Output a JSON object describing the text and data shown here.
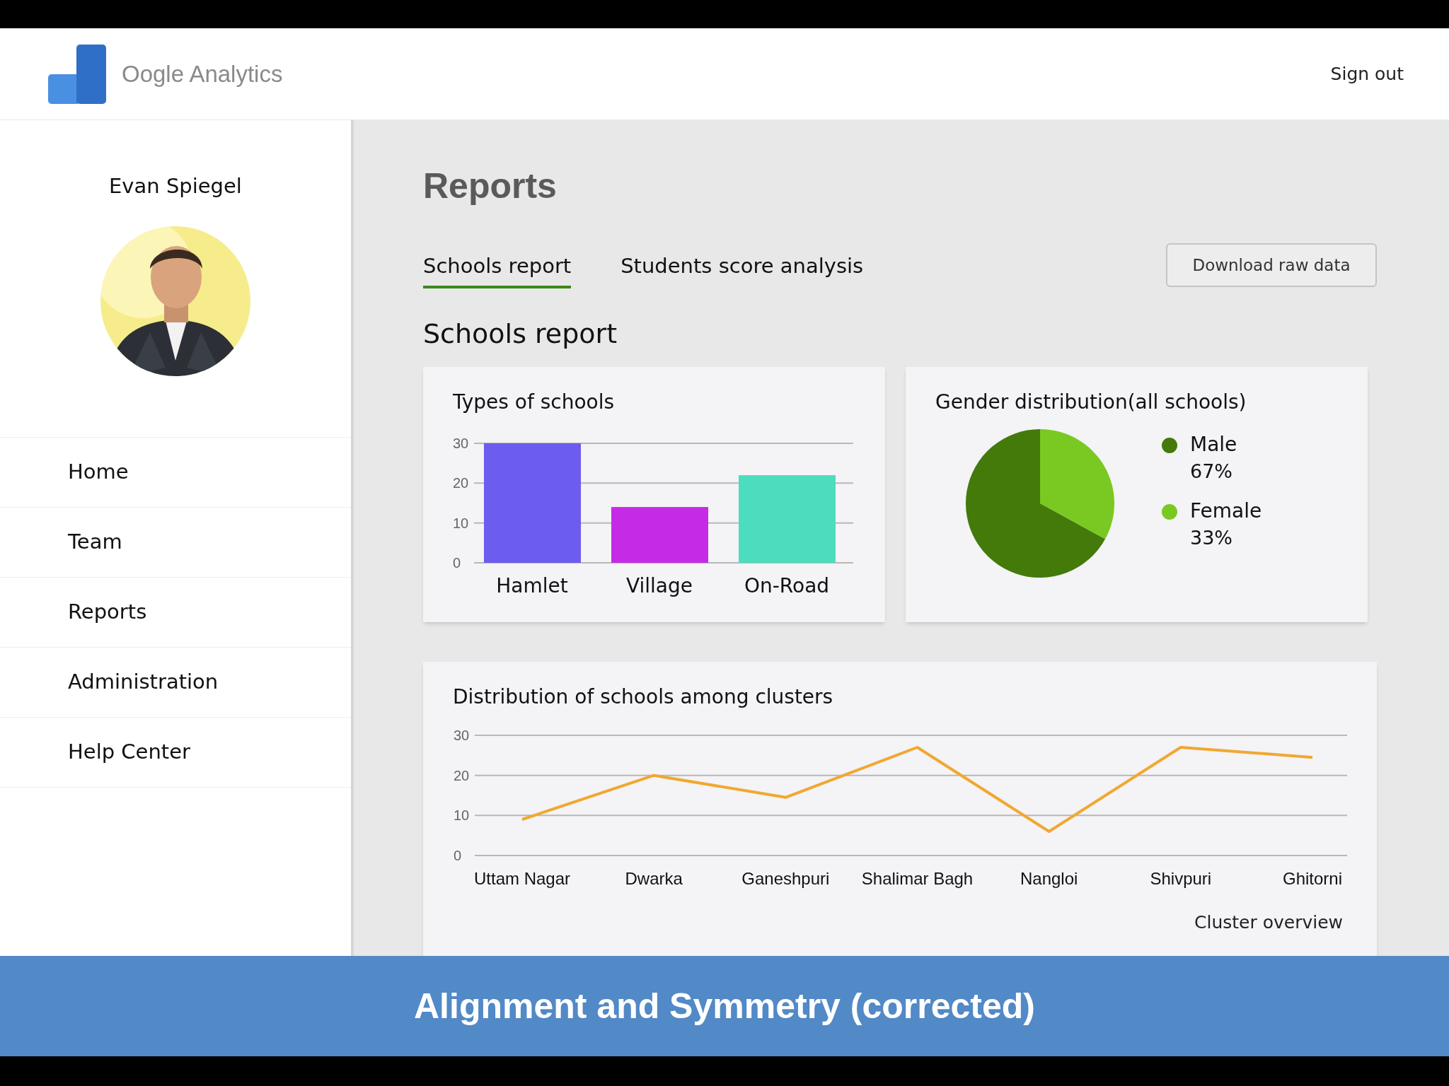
{
  "header": {
    "app_name": "Oogle Analytics",
    "sign_out": "Sign out"
  },
  "sidebar": {
    "user_name": "Evan Spiegel",
    "items": [
      {
        "label": "Home"
      },
      {
        "label": "Team"
      },
      {
        "label": "Reports"
      },
      {
        "label": "Administration"
      },
      {
        "label": "Help Center"
      }
    ]
  },
  "page_title": "Reports",
  "tabs": [
    {
      "label": "Schools report",
      "selected": true
    },
    {
      "label": "Students score analysis",
      "selected": false
    }
  ],
  "download_button": "Download raw data",
  "section_title": "Schools report",
  "cards": [
    {
      "title": "Types of schools",
      "chart_data": {
        "type": "bar",
        "categories": [
          "Hamlet",
          "Village",
          "On-Road"
        ],
        "stacked": true,
        "series": [
          {
            "color": "#6c5cf0",
            "values": [
              30,
              null,
              null
            ]
          },
          {
            "color": "#c52be6",
            "values": [
              null,
              14,
              null
            ]
          },
          {
            "color": "#4edcbf",
            "values": [
              null,
              null,
              22
            ]
          }
        ],
        "ylim": [
          0,
          30
        ],
        "yticks": [
          0,
          10,
          20,
          30
        ]
      }
    },
    {
      "title": "Gender distribution(all schools)",
      "chart_data": {
        "type": "pie",
        "categories": [
          "Male",
          "Female"
        ],
        "series": [
          {
            "values": [
              67,
              33
            ]
          }
        ],
        "colors": [
          "#437a0a",
          "#79c922"
        ],
        "value_labels": [
          "67%",
          "33%"
        ]
      }
    }
  ],
  "cluster_card": {
    "title": "Distribution of schools among clusters",
    "footer": "Cluster overview",
    "chart_data": {
      "type": "line",
      "categories": [
        "Uttam Nagar",
        "Dwarka",
        "Ganeshpuri",
        "Shalimar Bagh",
        "Nangloi",
        "Shivpuri",
        "Ghitorni"
      ],
      "series": [
        {
          "color": "#f0a830",
          "values": [
            9,
            20,
            14.5,
            27,
            6,
            27,
            24.5
          ]
        }
      ],
      "ylim": [
        0,
        30
      ],
      "yticks": [
        0,
        10,
        20,
        30
      ]
    }
  },
  "banner": "Alignment and Symmetry (corrected)"
}
